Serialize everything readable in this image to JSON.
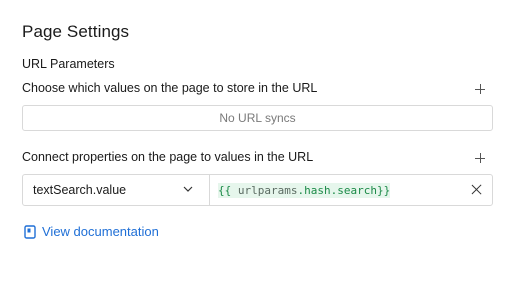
{
  "page": {
    "title": "Page Settings"
  },
  "url_params": {
    "section_label": "URL Parameters",
    "store_label": "Choose which values on the page to store in the URL",
    "empty_text": "No URL syncs",
    "connect_label": "Connect properties on the page to values in the URL",
    "bindings": [
      {
        "property": "textSearch.value",
        "expression_open": "{{ ",
        "expression_var": "urlparams",
        "expression_dot1": ".",
        "expression_key1": "hash",
        "expression_dot2": ".",
        "expression_key2": "search",
        "expression_close": "}}"
      }
    ]
  },
  "docs": {
    "link_label": "View documentation"
  },
  "colors": {
    "accent": "#1f6fd6",
    "code_bg": "#e6f6ec",
    "code_fg": "#1b8a47"
  }
}
